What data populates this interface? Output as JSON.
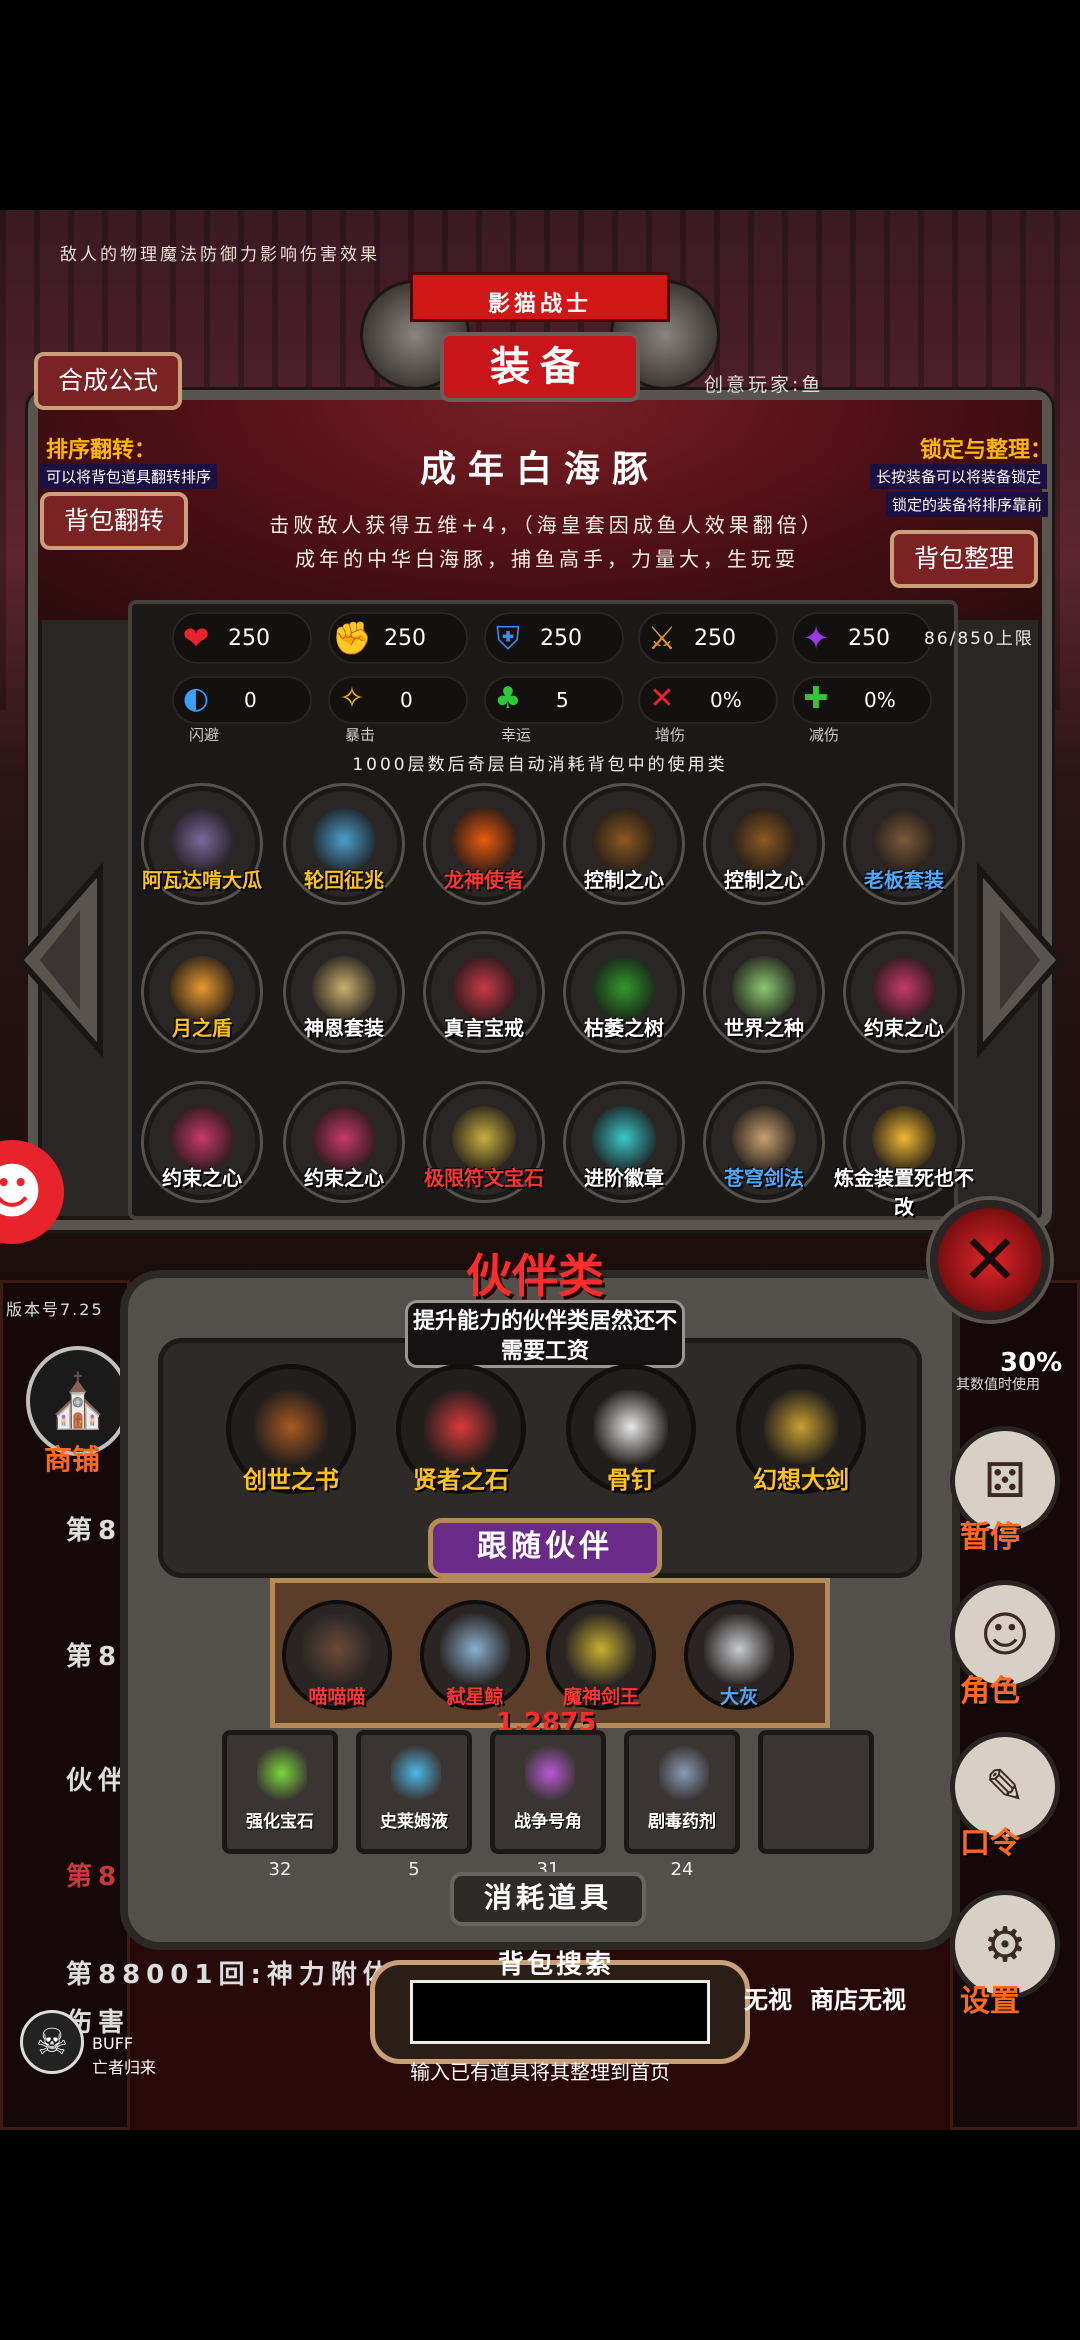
{
  "top_hint": "敌人的物理魔法防御力影响伤害效果",
  "banner": {
    "subtitle": "影猫战士",
    "title": "装备"
  },
  "creator": "创意玩家:鱼",
  "buttons": {
    "formula": "合成公式",
    "bag_flip": "背包翻转",
    "bag_sort": "背包整理"
  },
  "left_info": {
    "title": "排序翻转：",
    "desc": "可以将背包道具翻转排序"
  },
  "right_info": {
    "title": "锁定与整理：",
    "desc1": "长按装备可以将装备锁定",
    "desc2": "锁定的装备将排序靠前"
  },
  "item": {
    "name": "成年白海豚",
    "desc": "击败敌人获得五维+4，（海皇套因成鱼人效果翻倍）成年的中华白海豚，捕鱼高手，力量大，生玩耍"
  },
  "stats_main": [
    {
      "icon": "heart-icon",
      "glyph": "❤",
      "color": "#e8232b",
      "value": "250"
    },
    {
      "icon": "muscle-icon",
      "glyph": "✊",
      "color": "#f5b800",
      "value": "250"
    },
    {
      "icon": "armor-icon",
      "glyph": "⛨",
      "color": "#3a8ee8",
      "value": "250"
    },
    {
      "icon": "sword-icon",
      "glyph": "⚔",
      "color": "#d89c2a",
      "value": "250"
    },
    {
      "icon": "magic-icon",
      "glyph": "✦",
      "color": "#9a3ae8",
      "value": "250"
    }
  ],
  "capacity": "86/850上限",
  "stats_sub": [
    {
      "icon": "dodge-icon",
      "glyph": "◐",
      "color": "#3aa0ff",
      "value": "0",
      "label": "闪避"
    },
    {
      "icon": "crit-icon",
      "glyph": "✧",
      "color": "#f5b800",
      "value": "0",
      "label": "暴击"
    },
    {
      "icon": "luck-icon",
      "glyph": "♣",
      "color": "#2ec83a",
      "value": "5",
      "label": "幸运"
    },
    {
      "icon": "damage-up-icon",
      "glyph": "✕",
      "color": "#e8232b",
      "value": "0%",
      "label": "增伤"
    },
    {
      "icon": "damage-reduce-icon",
      "glyph": "✚",
      "color": "#2ec83a",
      "value": "0%",
      "label": "减伤"
    }
  ],
  "auto_note": "1000层数后奇层自动消耗背包中的使用类",
  "equipment": [
    {
      "name": "阿瓦达啃大瓜",
      "color": "gold",
      "art": "#7a6a9a"
    },
    {
      "name": "轮回征兆",
      "color": "gold",
      "art": "#4aa0c8"
    },
    {
      "name": "龙神使者",
      "color": "red",
      "art": "#e85a10"
    },
    {
      "name": "控制之心",
      "color": "",
      "art": "#8a5a20"
    },
    {
      "name": "控制之心",
      "color": "",
      "art": "#8a5a20"
    },
    {
      "name": "老板套装",
      "color": "blue",
      "art": "#7a5a3a"
    },
    {
      "name": "月之盾",
      "color": "gold",
      "art": "#e89a30"
    },
    {
      "name": "神恩套装",
      "color": "",
      "art": "#c8b070"
    },
    {
      "name": "真言宝戒",
      "color": "",
      "art": "#c83a4a"
    },
    {
      "name": "枯萎之树",
      "color": "",
      "art": "#2e9a2a"
    },
    {
      "name": "世界之种",
      "color": "",
      "art": "#8ac870"
    },
    {
      "name": "约束之心",
      "color": "",
      "art": "#c83a6a"
    },
    {
      "name": "约束之心",
      "color": "",
      "art": "#c83a6a"
    },
    {
      "name": "约束之心",
      "color": "",
      "art": "#c83a6a"
    },
    {
      "name": "极限符文宝石",
      "color": "red",
      "art": "#c8b040"
    },
    {
      "name": "进阶徽章",
      "color": "",
      "art": "#3ac8c8"
    },
    {
      "name": "苍穹剑法",
      "color": "blue",
      "art": "#c8a070"
    },
    {
      "name": "炼金装置死也不改",
      "color": "",
      "art": "#f0b830"
    }
  ],
  "partner": {
    "title": "伙伴类",
    "subtitle": "提升能力的伙伴类居然还不需要工资",
    "items": [
      {
        "name": "创世之书",
        "art": "#a85a20"
      },
      {
        "name": "贤者之石",
        "art": "#d83a3a"
      },
      {
        "name": "骨钉",
        "art": "#e8e8e8"
      },
      {
        "name": "幻想大剑",
        "art": "#c8a030"
      }
    ]
  },
  "follow": {
    "title": "跟随伙伴",
    "items": [
      {
        "name": "喵喵喵",
        "color": "#ff3434",
        "art": "#6a4a3a"
      },
      {
        "name": "弑星鲸",
        "color": "#ff3434",
        "art": "#8ab0d0"
      },
      {
        "name": "魔神剑王",
        "color": "#ff3434",
        "art": "#c8b030"
      },
      {
        "name": "大灰",
        "color": "#4ea9ff",
        "art": "#c8ccd0"
      }
    ],
    "power": "1.2875"
  },
  "consumables": {
    "title": "消耗道具",
    "items": [
      {
        "name": "强化宝石",
        "count": "32",
        "art": "#7ad83a"
      },
      {
        "name": "史莱姆液",
        "count": "5",
        "art": "#4ab8e8"
      },
      {
        "name": "战争号角",
        "count": "31",
        "art": "#b85ad8"
      },
      {
        "name": "剧毒药剂",
        "count": "24",
        "art": "#8a9ab8"
      },
      {
        "name": "",
        "count": "",
        "art": "#3a3533"
      }
    ]
  },
  "search": {
    "title": "背包搜索",
    "placeholder": "",
    "hint": "输入已有道具将其整理到首页"
  },
  "side": {
    "shop": "商铺",
    "version": "版本号7.25",
    "percent": "30%",
    "percent_sub": "其数值时使用",
    "pause": "暂停",
    "role": "角色",
    "password": "口令",
    "settings": "设置",
    "log1": "第8",
    "log2": "第8800",
    "log3": "伙伴",
    "log4": "第8",
    "log5": "第88001回:神力附体",
    "log6": "伤害",
    "free1": "无视",
    "free2": "商店无视",
    "buff_label1": "BUFF",
    "buff_label2": "亡者归来"
  }
}
